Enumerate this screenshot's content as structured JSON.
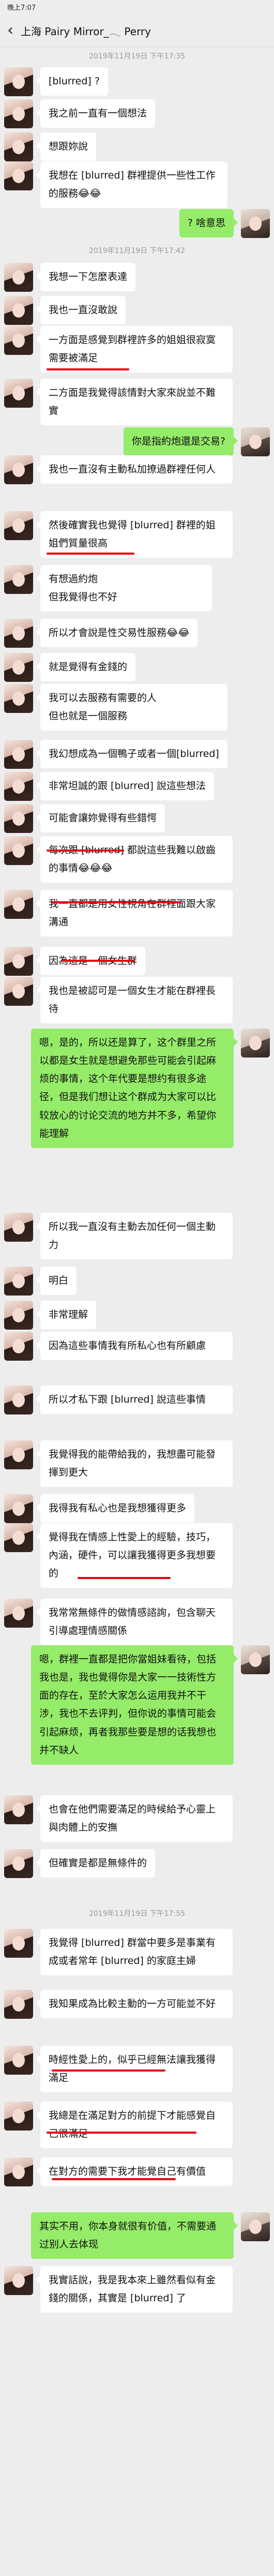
{
  "status_bar": {
    "time": "晚上7:07"
  },
  "header": {
    "back_icon": "‹",
    "title": "上海 Pairy Mirror_𓂃 Perry"
  },
  "timestamps": [
    "2019年11月19日 下午17:35",
    "2019年11月19日 下午17:42",
    "2019年11月19日 下午17:55"
  ],
  "messages": [
    {
      "side": "left",
      "text": "[blurred] ?"
    },
    {
      "side": "left",
      "text": "我之前一直有一個想法"
    },
    {
      "side": "left",
      "text": "想跟妳說"
    },
    {
      "side": "left",
      "text": "我想在 [blurred] 群裡提供一些性工作的服務😂😂"
    },
    {
      "side": "right",
      "text": "? 啥意思"
    },
    {
      "side": "left",
      "text": "我想一下怎麼表達"
    },
    {
      "side": "left",
      "text": "我也一直沒敢說"
    },
    {
      "side": "left",
      "text": "一方面是感覺到群裡許多的姐姐很寂寞需要被滿足"
    },
    {
      "side": "left",
      "text": "二方面是我覺得該情對大家來說並不難實"
    },
    {
      "side": "right",
      "text": "你是指約炮還是交易?"
    },
    {
      "side": "left",
      "text": "我也一直沒有主動私加撩過群裡任何人"
    },
    {
      "side": "left",
      "text": "然後確實我也覺得 [blurred] 群裡的姐姐們質量很高"
    },
    {
      "side": "left",
      "text": "有想過約炮\n但我覺得也不好"
    },
    {
      "side": "left",
      "text": "所以才會說是性交易性服務😂😂"
    },
    {
      "side": "left",
      "text": "就是覺得有金錢的"
    },
    {
      "side": "left",
      "text": "我可以去服務有需要的人\n但也就是一個服務"
    },
    {
      "side": "left",
      "text": "我幻想成為一個鴨子或者一個[blurred]"
    },
    {
      "side": "left",
      "text": "非常坦誠的跟 [blurred] 說這些想法"
    },
    {
      "side": "left",
      "text": "可能會讓妳覺得有些錯愕"
    },
    {
      "side": "left",
      "text": "每次跟 [blurred] 都說這些我難以啟齒的事情😂😂😂"
    },
    {
      "side": "left",
      "text": "我一直都是用女性視角在群裡面跟大家溝通"
    },
    {
      "side": "left",
      "text": "因為這是一個女生群"
    },
    {
      "side": "left",
      "text": "我也是被認可是一個女生才能在群裡長待"
    },
    {
      "side": "right",
      "text": "嗯，是的，所以还是算了，这个群里之所以都是女生就是想避免那些可能会引起麻烦的事情，这个年代要是想约有很多途径，但是我们想让这个群成为大家可以比较放心的讨论交流的地方并不多，希望你能理解"
    },
    {
      "side": "left",
      "text": "所以我一直沒有主動去加任何一個主動力"
    },
    {
      "side": "left",
      "text": "明白"
    },
    {
      "side": "left",
      "text": "非常理解"
    },
    {
      "side": "left",
      "text": "因為這些事情我有所私心也有所顧慮"
    },
    {
      "side": "left",
      "text": "所以才私下跟 [blurred] 說這些事情"
    },
    {
      "side": "left",
      "text": "我覺得我的能帶給我的，我想盡可能發揮到更大"
    },
    {
      "side": "left",
      "text": "我得我有私心也是我想獲得更多"
    },
    {
      "side": "left",
      "text": "覺得我在情感上性愛上的經驗，技巧，內涵，硬件，可以讓我獲得更多我想要的"
    },
    {
      "side": "left",
      "text": "我常常無條件的做情感諮詢，包含聊天引導處理情感關係"
    },
    {
      "side": "right",
      "text": "嗯，群裡一直都是把你當姐妹看待，包括我也是，我也覺得你是大家一一技術性方面的存在，至於大家怎么运用我并不干涉，我也不去评判，但你说的事情可能会引起麻烦，再者我那些要是想的话我想也并不缺人"
    },
    {
      "side": "left",
      "text": "也會在他們需要滿足的時候給予心靈上與肉體上的安撫"
    },
    {
      "side": "left",
      "text": "但確實是都是無條件的"
    },
    {
      "side": "left",
      "text": "我覺得 [blurred] 群當中要多是事業有成或者常年 [blurred] 的家庭主婦"
    },
    {
      "side": "left",
      "text": "我知果成為比較主動的一方可能並不好"
    },
    {
      "side": "left",
      "text": "時經性愛上的，似乎已經無法讓我獲得滿足"
    },
    {
      "side": "left",
      "text": "我總是在滿足對方的前提下才能感覺自己很滿足"
    },
    {
      "side": "left",
      "text": "在對方的需要下我才能覺自己有價值"
    },
    {
      "side": "right",
      "text": "其实不用，你本身就很有价值，不需要通过别人去体现"
    },
    {
      "side": "left",
      "text": "我實話說，我是我本來上雖然看似有金錢的關係，其實是 [blurred] 了"
    }
  ]
}
